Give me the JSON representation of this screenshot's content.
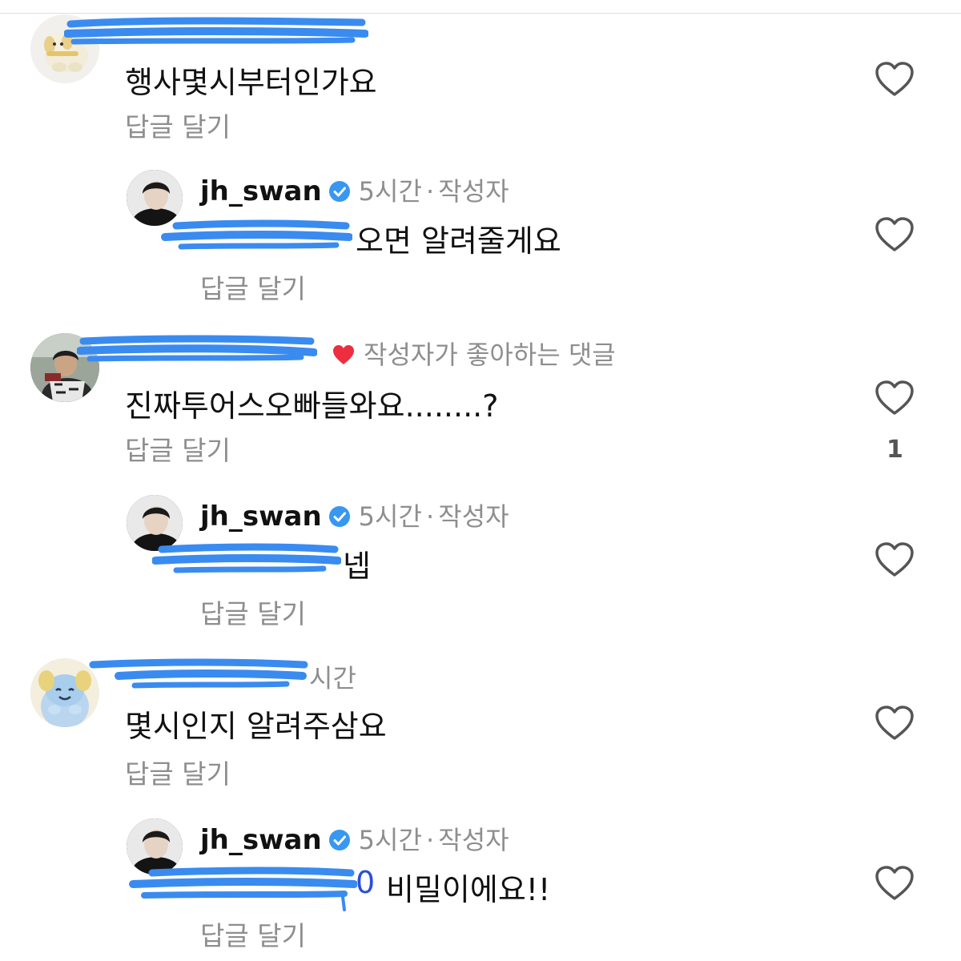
{
  "colors": {
    "background": "#ffffff",
    "text": "#111111",
    "muted": "#8e8e8e",
    "verified": "#3897f0",
    "liked_heart": "#ed2e3e",
    "redaction": "#3a8bf0"
  },
  "threads": [
    {
      "comment": {
        "text": "행사몇시부터인가요",
        "reply_label": "답글 달기",
        "avatar_icon": "plush-dog-avatar"
      },
      "reply": {
        "username": "jh_swan",
        "time": "5시간",
        "separator": "·",
        "author_badge": "작성자",
        "text": "오면 알려줄게요",
        "reply_label": "답글 달기"
      }
    },
    {
      "comment": {
        "creator_liked_label": "작성자가 좋아하는 댓글",
        "text": "진짜투어스오빠들와요........?",
        "reply_label": "답글 달기",
        "like_count": "1",
        "avatar_icon": "person-avatar"
      },
      "reply": {
        "username": "jh_swan",
        "time": "5시간",
        "separator": "·",
        "author_badge": "작성자",
        "text": "넵",
        "reply_label": "답글 달기"
      }
    },
    {
      "comment": {
        "time_fragment": "시간",
        "text": "몇시인지 알려주삼요",
        "reply_label": "답글 달기",
        "avatar_icon": "blue-character-avatar"
      },
      "reply": {
        "username": "jh_swan",
        "time": "5시간",
        "separator": "·",
        "author_badge": "작성자",
        "mention_tail": "0",
        "text": "비밀이에요!!",
        "reply_label": "답글 달기"
      }
    }
  ]
}
